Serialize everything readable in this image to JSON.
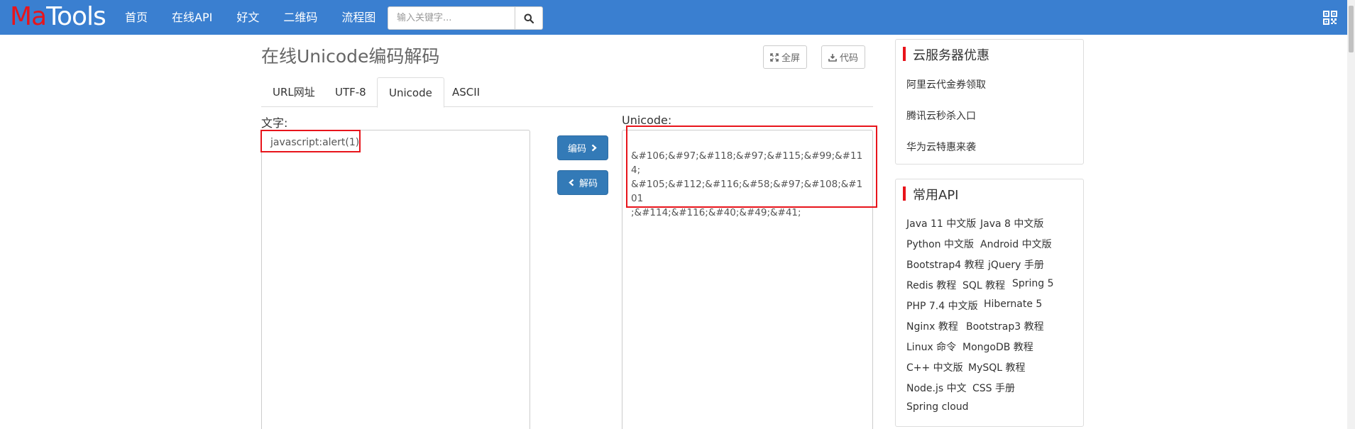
{
  "navbar": {
    "brand_part1": "Ma",
    "brand_part2": "Tools",
    "links": [
      "首页",
      "在线API",
      "好文",
      "二维码",
      "流程图"
    ],
    "search_placeholder": "输入关键字...",
    "search_icon": "search-icon",
    "qr_icon": "qrcode-icon",
    "bg_color": "#3a7fd0",
    "brand_accent": "#e8141b"
  },
  "main": {
    "title": "在线Unicode编码解码",
    "fullscreen_label": "全屏",
    "code_label": "代码",
    "tabs": [
      "URL网址",
      "UTF-8",
      "Unicode",
      "ASCII"
    ],
    "active_tab": "Unicode",
    "text_label": "文字:",
    "text_value": "javascript:alert(1)",
    "unicode_label": "Unicode:",
    "unicode_value": "&#106;&#97;&#118;&#97;&#115;&#99;&#114;\n&#105;&#112;&#116;&#58;&#97;&#108;&#101\n;&#114;&#116;&#40;&#49;&#41;",
    "encode_label": "编码",
    "decode_label": "解码",
    "button_color": "#337ab7",
    "highlight_color": "#e8141b"
  },
  "sidebar": {
    "cloud": {
      "title": "云服务器优惠",
      "links": [
        "阿里云代金券领取",
        "腾讯云秒杀入口",
        "华为云特惠来袭"
      ]
    },
    "api": {
      "title": "常用API",
      "rows": [
        [
          "Java 11 中文版",
          "Java 8 中文版"
        ],
        [
          "Python 中文版",
          "Android 中文版"
        ],
        [
          "Bootstrap4 教程",
          "jQuery 手册"
        ],
        [
          "Redis 教程",
          "SQL 教程",
          "Spring 5"
        ],
        [
          "PHP 7.4 中文版",
          "Hibernate 5"
        ],
        [
          "Nginx 教程",
          "Bootstrap3 教程"
        ],
        [
          "Linux 命令",
          "MongoDB 教程"
        ],
        [
          "C++ 中文版",
          "MySQL 教程"
        ],
        [
          "Node.js 中文",
          "CSS 手册"
        ],
        [
          "Spring cloud"
        ]
      ]
    }
  }
}
